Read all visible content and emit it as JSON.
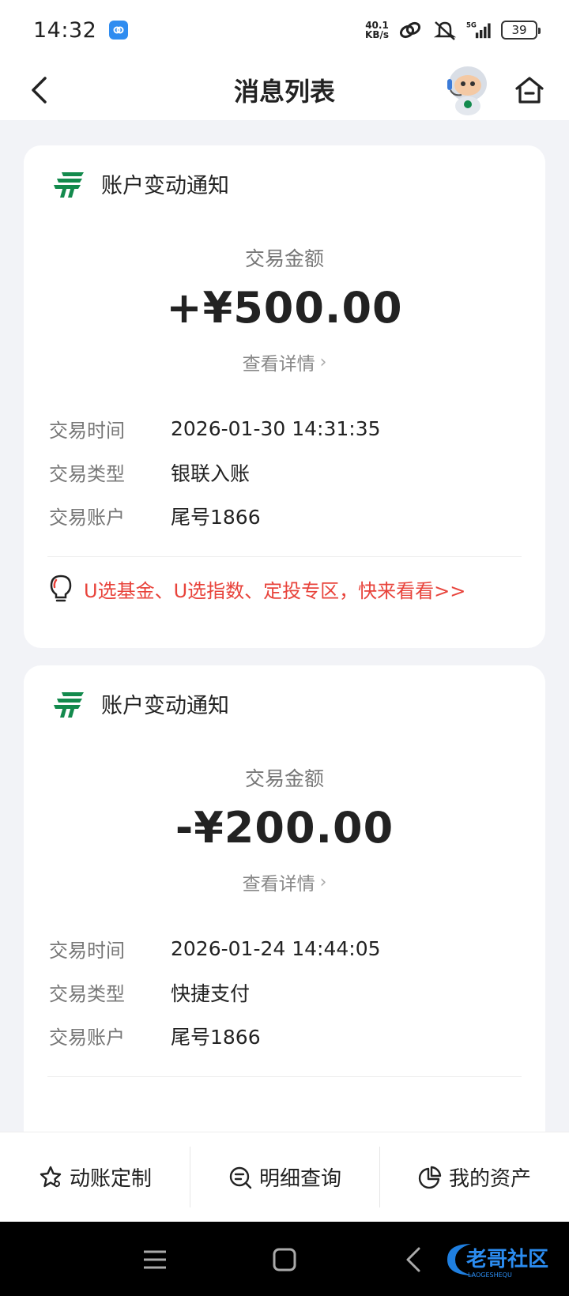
{
  "status_bar": {
    "time": "14:32",
    "net_speed_value": "40.1",
    "net_speed_unit": "KB/s",
    "network": "5G",
    "battery": "39"
  },
  "nav": {
    "title": "消息列表"
  },
  "cards": [
    {
      "title": "账户变动通知",
      "amount_label": "交易金额",
      "amount": "+¥500.00",
      "detail_link": "查看详情",
      "rows": [
        {
          "key": "交易时间",
          "value": "2026-01-30 14:31:35"
        },
        {
          "key": "交易类型",
          "value": "银联入账"
        },
        {
          "key": "交易账户",
          "value": "尾号1866"
        }
      ],
      "promo": "U选基金、U选指数、定投专区，快来看看>>"
    },
    {
      "title": "账户变动通知",
      "amount_label": "交易金额",
      "amount": "-¥200.00",
      "detail_link": "查看详情",
      "rows": [
        {
          "key": "交易时间",
          "value": "2026-01-24 14:44:05"
        },
        {
          "key": "交易类型",
          "value": "快捷支付"
        },
        {
          "key": "交易账户",
          "value": "尾号1866"
        }
      ]
    }
  ],
  "tabs": [
    {
      "label": "动账定制",
      "icon": "star-settings-icon"
    },
    {
      "label": "明细查询",
      "icon": "search-list-icon"
    },
    {
      "label": "我的资产",
      "icon": "pie-chart-icon"
    }
  ],
  "watermark": {
    "text": "老哥社区",
    "sub": "LAOGESHEQU"
  },
  "colors": {
    "accent_red": "#e8433b",
    "logo_green": "#138a4d",
    "background": "#f2f3f7"
  }
}
